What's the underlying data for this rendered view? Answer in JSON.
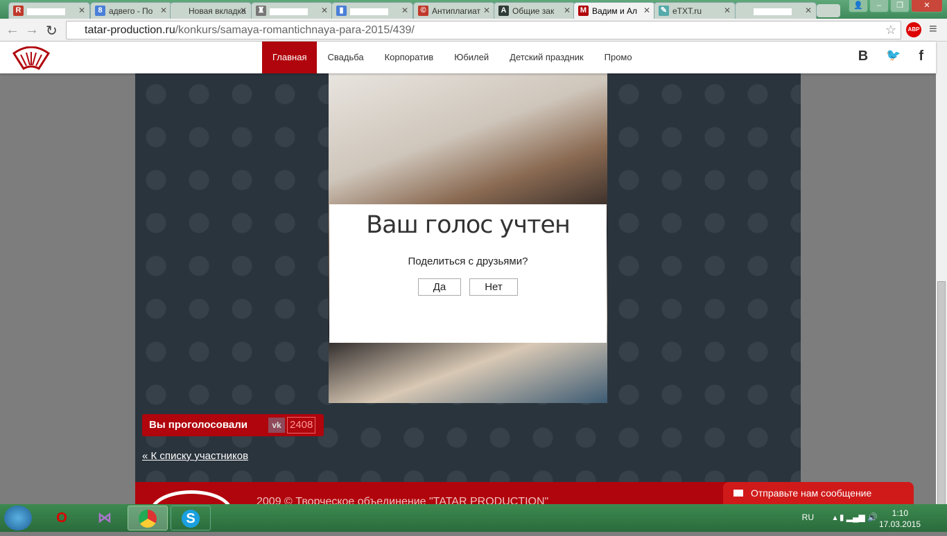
{
  "browser": {
    "tabs": [
      {
        "label": "",
        "icon": "R",
        "color": "#c0392b"
      },
      {
        "label": "адвего - По",
        "icon": "8",
        "color": "#4a7fd8"
      },
      {
        "label": "Новая вкладка",
        "icon": "",
        "color": ""
      },
      {
        "label": "",
        "icon": "♜",
        "color": "#777"
      },
      {
        "label": "",
        "icon": "▮",
        "color": "#4a7fd8"
      },
      {
        "label": "Антиплагиат",
        "icon": "©",
        "color": "#c0392b"
      },
      {
        "label": "Общие зак",
        "icon": "A",
        "color": "#2e3b36"
      },
      {
        "label": "Вадим и Ал",
        "icon": "M",
        "color": "#b0050c"
      },
      {
        "label": "eTXT.ru",
        "icon": "✎",
        "color": "#5aa"
      },
      {
        "label": "",
        "icon": "",
        "color": ""
      }
    ],
    "url_domain": "tatar-production.ru",
    "url_path": "/konkurs/samaya-romantichnaya-para-2015/439/",
    "abp": "ABP"
  },
  "site": {
    "menu": [
      "Главная",
      "Свадьба",
      "Корпоратив",
      "Юбилей",
      "Детский праздник",
      "Промо"
    ],
    "social": [
      "B",
      "🐦",
      "f"
    ],
    "modal": {
      "title": "Ваш голос учтен",
      "question": "Поделиться с друзьями?",
      "yes": "Да",
      "no": "Нет"
    },
    "vote": {
      "label": "Вы проголосовали",
      "vk": "vk",
      "count": "2408"
    },
    "back_link": "« К списку участников",
    "footer": "2009 © Творческое объединение \"TATAR PRODUCTION\"",
    "message_button": "Отправьте нам сообщение"
  },
  "taskbar": {
    "lang": "RU",
    "time": "1:10",
    "date": "17.03.2015"
  },
  "colors": {
    "brand": "#b0050c",
    "bg": "#2a343d"
  }
}
